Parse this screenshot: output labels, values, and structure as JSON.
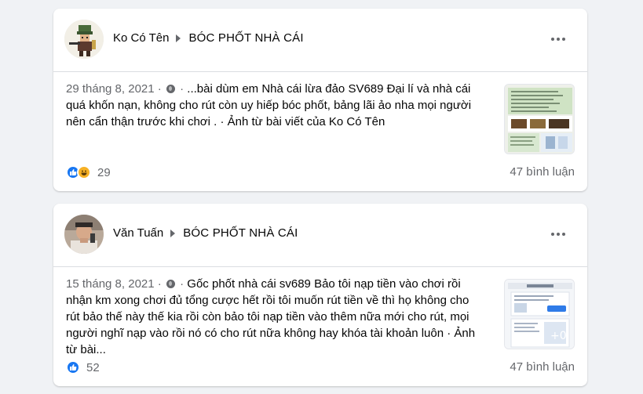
{
  "posts": [
    {
      "author": "Ko Có Tên",
      "group": "BÓC PHỐT NHÀ CÁI",
      "date": "29 tháng 8, 2021",
      "separator": "·",
      "text": "...bài dùm em Nhà cái lừa đảo SV689 Đại lí và nhà cái quá khốn nạn, không cho rút còn uy hiếp bóc phốt, bảng lãi ảo nha mọi người nên cẩn thận trước khi chơi . · Ảnh từ bài viết của Ko Có Tên",
      "reactions": [
        "like-icon",
        "haha-icon"
      ],
      "reaction_count": "29",
      "comments": "47 bình luận"
    },
    {
      "author": "Văn Tuấn",
      "group": "BÓC PHỐT NHÀ CÁI",
      "date": "15 tháng 8, 2021",
      "separator": "·",
      "text": "Gốc phốt nhà cái sv689 Bảo tôi nạp tiền vào chơi rồi nhận km xong chơi đủ tổng cược hết rồi tôi muốn rút tiền về thì họ không cho rút bảo thế này thế kia rồi còn bảo tôi nạp tiền vào thêm nữa mới cho rút, mọi người nghĩ nạp vào rồi nó có cho rút nữa không hay khóa tài khoản luôn · Ảnh từ bài...",
      "reactions": [
        "like-icon"
      ],
      "reaction_count": "52",
      "comments": "47 bình luận"
    }
  ],
  "colors": {
    "background": "#f0f2f5",
    "card": "#ffffff",
    "secondary_text": "#65676b",
    "like_blue": "#1877f2",
    "haha_yellow": "#f7b125"
  }
}
